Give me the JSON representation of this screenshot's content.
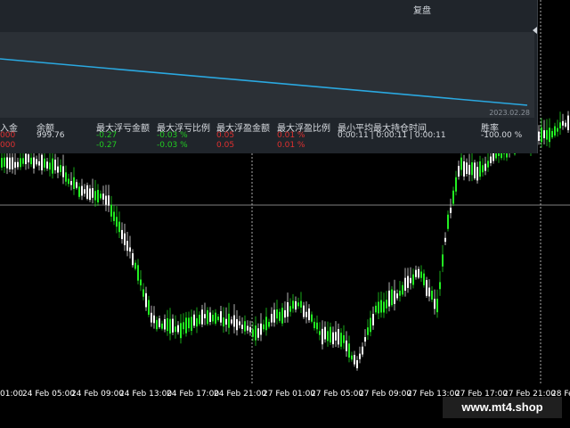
{
  "time_axis": {
    "labels": [
      "01:00",
      "24 Feb 05:00",
      "24 Feb 09:00",
      "24 Feb 13:00",
      "24 Feb 17:00",
      "24 Feb 21:00",
      "27 Feb 01:00",
      "27 Feb 05:00",
      "27 Feb 09:00",
      "27 Feb 13:00",
      "27 Feb 17:00",
      "27 Feb 21:00",
      "28 Fe"
    ]
  },
  "colors": {
    "bull": "#22ee22",
    "bear": "#ffffff",
    "equity_line": "#2aa8e0",
    "negative": "#22cc22",
    "positive_red": "#e03030",
    "grid": "#aaaaaa"
  },
  "panel": {
    "title": "复盘",
    "equity_date": "2023.02.28",
    "headers": [
      "入金",
      "余额",
      "最大浮亏金额",
      "最大浮亏比例",
      "最大浮盈金额",
      "最大浮盈比例",
      "最小平均最大持仓时间",
      "胜率"
    ],
    "rows": [
      {
        "deposit": "000",
        "balance": "999.76",
        "max_float_loss": "-0.27",
        "max_float_loss_pct": "-0.03 %",
        "max_float_profit": "0.05",
        "max_float_profit_pct": "0.01 %",
        "hold_time": "0:00:11 | 0:00:11 | 0:00:11",
        "win_rate": "-100.00 %"
      },
      {
        "deposit": "000",
        "balance": "",
        "max_float_loss": "-0.27",
        "max_float_loss_pct": "-0.03 %",
        "max_float_profit": "0.05",
        "max_float_profit_pct": "0.01 %",
        "hold_time": "",
        "win_rate": ""
      }
    ]
  },
  "watermark": "www.mt4.shop"
}
